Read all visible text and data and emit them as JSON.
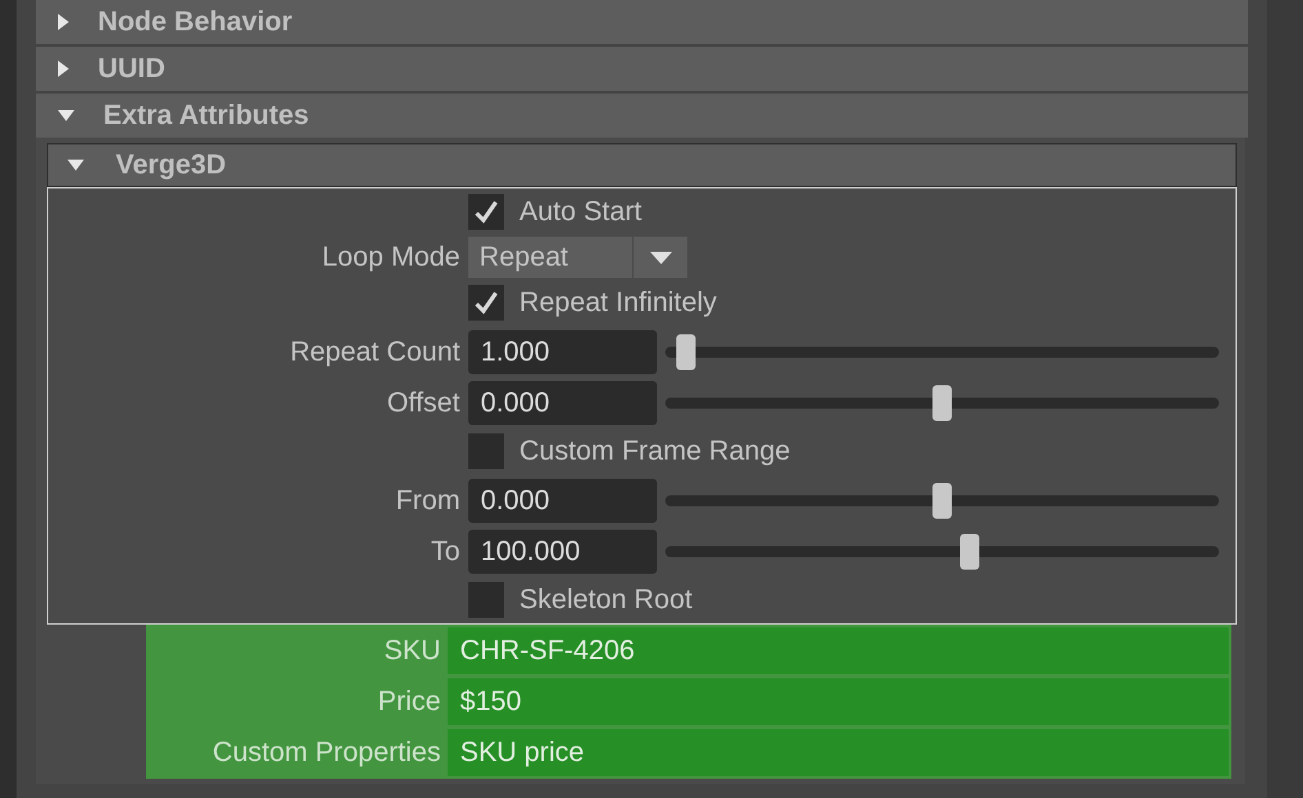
{
  "sections": [
    {
      "label": "Node Behavior",
      "expanded": false
    },
    {
      "label": "UUID",
      "expanded": false
    },
    {
      "label": "Extra Attributes",
      "expanded": true,
      "subsection": {
        "label": "Verge3D",
        "expanded": true,
        "rows": [
          {
            "kind": "checkbox",
            "label": "Auto Start",
            "checked": true
          },
          {
            "kind": "dropdown",
            "label": "Loop Mode",
            "value": "Repeat"
          },
          {
            "kind": "checkbox",
            "label": "Repeat Infinitely",
            "checked": true
          },
          {
            "kind": "slider",
            "label": "Repeat Count",
            "value": "1.000",
            "level": 0.02
          },
          {
            "kind": "slider",
            "label": "Offset",
            "value": "0.000",
            "level": 0.5
          },
          {
            "kind": "checkbox",
            "label": "Custom Frame Range",
            "checked": false
          },
          {
            "kind": "slider",
            "label": "From",
            "value": "0.000",
            "level": 0.5
          },
          {
            "kind": "slider",
            "label": "To",
            "value": "100.000",
            "level": 0.55
          },
          {
            "kind": "checkbox",
            "label": "Skeleton Root",
            "checked": false
          }
        ]
      },
      "custom_fields": [
        {
          "label": "SKU",
          "value": "CHR-SF-4206"
        },
        {
          "label": "Price",
          "value": "$150"
        },
        {
          "label": "Custom Properties",
          "value": "SKU price"
        }
      ]
    }
  ]
}
